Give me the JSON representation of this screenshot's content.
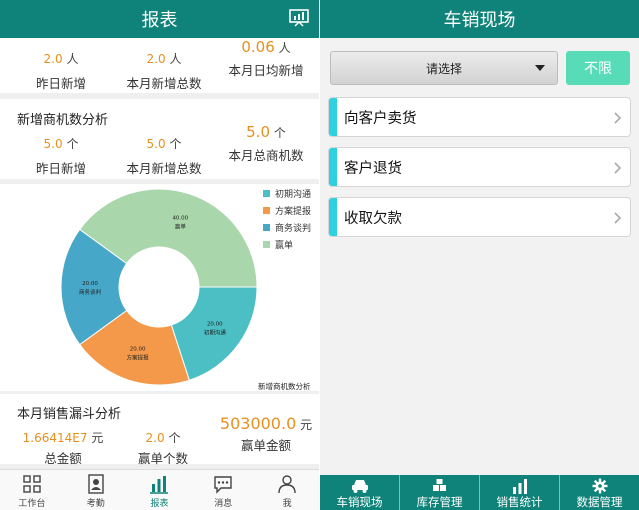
{
  "left": {
    "title": "报表",
    "summary": {
      "stats": [
        {
          "value": "2.0",
          "unit": "人",
          "label": "昨日新增"
        },
        {
          "value": "2.0",
          "unit": "人",
          "label": "本月新增总数"
        },
        {
          "value": "0.06",
          "unit": "人",
          "label": "本月日均新增"
        }
      ]
    },
    "opportunities": {
      "title": "新增商机数分析",
      "stats": [
        {
          "value": "5.0",
          "unit": "个",
          "label": "昨日新增"
        },
        {
          "value": "5.0",
          "unit": "个",
          "label": "本月新增总数"
        },
        {
          "value": "5.0",
          "unit": "个",
          "label": "本月总商机数"
        }
      ]
    },
    "chart_data": {
      "type": "pie",
      "title": "新增商机数分析",
      "categories": [
        "初期沟通",
        "方案提报",
        "商务谈判",
        "赢单"
      ],
      "values": [
        20,
        20,
        20,
        40
      ],
      "slice_labels": [
        "20.00\n初期沟通",
        "20.00\n方案提报",
        "20.00\n商务谈判",
        "40.00\n赢单"
      ],
      "colors": [
        "#4bbfc4",
        "#f4994a",
        "#46a7c9",
        "#a9d6ab"
      ],
      "legend": "top-right",
      "donut": true
    },
    "funnel": {
      "title": "本月销售漏斗分析",
      "stats": [
        {
          "value": "1.66414E7",
          "unit": "元",
          "label": "总金额"
        },
        {
          "value": "2.0",
          "unit": "个",
          "label": "赢单个数"
        },
        {
          "value": "503000.0",
          "unit": "元",
          "label": "赢单金额"
        }
      ]
    },
    "tabs": [
      {
        "label": "工作台",
        "icon": "grid-icon"
      },
      {
        "label": "考勤",
        "icon": "contact-card-icon"
      },
      {
        "label": "报表",
        "icon": "bar-chart-icon",
        "active": true
      },
      {
        "label": "消息",
        "icon": "chat-icon"
      },
      {
        "label": "我",
        "icon": "person-icon"
      }
    ]
  },
  "right": {
    "title": "车销现场",
    "select_placeholder": "请选择",
    "unlimited_button": "不限",
    "menu": [
      {
        "label": "向客户卖货"
      },
      {
        "label": "客户退货"
      },
      {
        "label": "收取欠款"
      }
    ],
    "tabs": [
      {
        "label": "车销现场",
        "icon": "car-icon"
      },
      {
        "label": "库存管理",
        "icon": "boxes-icon"
      },
      {
        "label": "销售统计",
        "icon": "bar-chart-icon"
      },
      {
        "label": "数据管理",
        "icon": "gear-icon"
      }
    ]
  },
  "colors": {
    "primary": "#0f8379",
    "accent_orange": "#e8901e",
    "cyan_accent": "#2fd0df",
    "unlimited_green": "#57dcb7"
  }
}
